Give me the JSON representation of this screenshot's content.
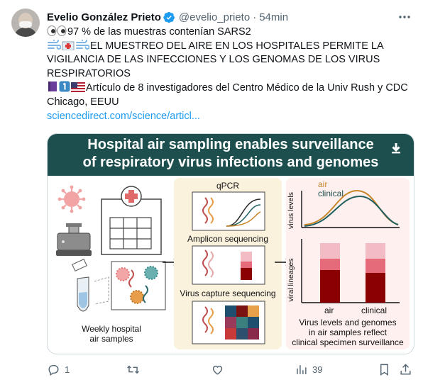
{
  "author": {
    "name": "Evelio González Prieto",
    "handle": "@evelio_prieto",
    "separator": "·",
    "time": "54min"
  },
  "tweet": {
    "line1": "97 % de las muestras contenían SARS2",
    "line2": "EL MUESTREO DEL AIRE EN LOS HOSPITALES PERMITE LA VIGILANCIA DE LAS INFECCIONES Y LOS GENOMAS DE LOS VIRUS RESPIRATORIOS",
    "line3": "Artículo de 8 investigadores del Centro Médico de la Univ Rush y CDC Chicago, EEUU",
    "link": "sciencedirect.com/science/articl..."
  },
  "figure": {
    "title_line1": "Hospital air sampling enables surveillance",
    "title_line2": "of respiratory virus infections and genomes",
    "panel1_caption_1": "Weekly hospital",
    "panel1_caption_2": "air samples",
    "qpcr_label": "qPCR",
    "amplicon_label": "Amplicon sequencing",
    "capture_label": "Virus capture sequencing",
    "legend_air": "air",
    "legend_clinical": "clinical",
    "y_virus_levels": "virus levels",
    "y_viral_lineages": "viral lineages",
    "bar_air": "air",
    "bar_clinical": "clinical",
    "panel3_caption_1": "Virus levels and genomes",
    "panel3_caption_2": "in air samples reflect",
    "panel3_caption_3": "clinical specimen surveillance",
    "colors": {
      "banner": "#1d4f4f",
      "air": "#c8862a",
      "clinical": "#1f5f5f"
    }
  },
  "actions": {
    "replies": "1",
    "retweets": "",
    "likes": "",
    "views": "39"
  }
}
